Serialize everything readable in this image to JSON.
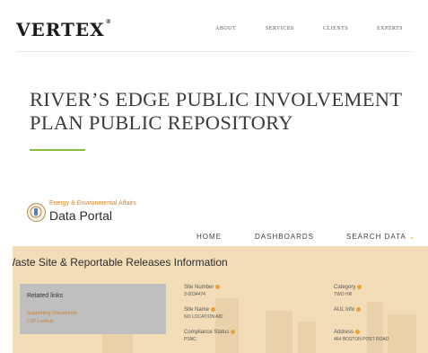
{
  "header": {
    "logo": "VERTEX",
    "logo_tm": "®",
    "nav": [
      "ABOUT",
      "SERVICES",
      "CLIENTS",
      "EXPERTS"
    ]
  },
  "hero": {
    "title_line1": "RIVER’S EDGE PUBLIC INVOLVEMENT",
    "title_line2": "PLAN PUBLIC REPOSITORY",
    "accent_color": "#8bbd3c"
  },
  "portal": {
    "subtitle": "Energy & Environmental Affairs",
    "name": "Data Portal",
    "nav": {
      "home": "HOME",
      "dashboards": "DASHBOARDS",
      "search": "SEARCH DATA",
      "search_caret": "⌄"
    },
    "section_title": "Waste Site & Reportable Releases Information",
    "related": {
      "title": "Related links",
      "links": [
        "Supporting Documents",
        "LSP Lookup"
      ]
    },
    "fields": {
      "site_number_label": "Site Number",
      "site_number_value": "3-0034474",
      "site_name_label": "Site Name",
      "site_name_value": "NO LOCATION AID",
      "compliance_label": "Compliance Status",
      "compliance_value": "PSNC",
      "category_label": "Category",
      "category_value": "TWO HR",
      "aul_label": "AUL Info",
      "address_label": "Address",
      "address_value": "464 BOSTON POST ROAD"
    },
    "band_color": "#f3ddb9",
    "highlight_color": "#e8a33b"
  }
}
